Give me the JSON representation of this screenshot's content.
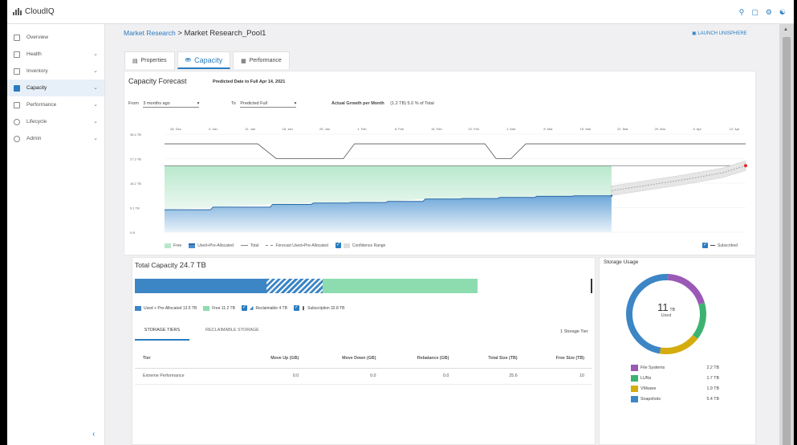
{
  "app": {
    "name": "CloudIQ"
  },
  "sidebar": {
    "items": [
      {
        "label": "Overview",
        "chevron": false,
        "active": false
      },
      {
        "label": "Health",
        "chevron": true,
        "active": false
      },
      {
        "label": "Inventory",
        "chevron": true,
        "active": false
      },
      {
        "label": "Capacity",
        "chevron": true,
        "active": true
      },
      {
        "label": "Performance",
        "chevron": true,
        "active": false
      },
      {
        "label": "Lifecycle",
        "chevron": true,
        "active": false
      },
      {
        "label": "Admin",
        "chevron": true,
        "active": false
      }
    ]
  },
  "header": {
    "breadcrumb_link": "Market Research",
    "breadcrumb_sep": " > ",
    "breadcrumb_current": "Market Research_Pool1",
    "launch": "LAUNCH UNISPHERE"
  },
  "tabs": [
    {
      "label": "Properties",
      "icon": "properties-icon"
    },
    {
      "label": "Capacity",
      "icon": "database-icon"
    },
    {
      "label": "Performance",
      "icon": "chart-icon"
    }
  ],
  "forecast": {
    "title": "Capacity Forecast",
    "subtitle": "Predicted Date to Full Apr 14, 2021",
    "from_label": "From",
    "from_value": "3 months ago",
    "to_label": "To",
    "to_value": "Predicted Full",
    "growth_label": "Actual Growth per Month",
    "growth_value": "(1.2 TB) 5.0 % of Total"
  },
  "chart_data": {
    "type": "area",
    "x_dates": [
      "28. Dec",
      "4. Jan",
      "11. Jan",
      "18. Jan",
      "25. Jan",
      "1. Feb",
      "8. Feb",
      "15. Feb",
      "22. Feb",
      "1. Mar",
      "8. Mar",
      "15. Mar",
      "22. Mar",
      "29. Mar",
      "5. Apr",
      "12. Apr"
    ],
    "y_ticks": [
      "36.4 TB",
      "27.3 TB",
      "18.2 TB",
      "9.1 TB",
      "0 B"
    ],
    "ylim": [
      0,
      36.4
    ],
    "series": [
      {
        "name": "Total",
        "values": [
          24.7,
          24.7,
          24.7,
          24.7,
          24.7,
          24.7,
          24.7,
          24.7,
          24.7,
          24.7,
          24.7,
          24.7
        ]
      },
      {
        "name": "Used+Pre-Allocated",
        "x": [
          0,
          1.3,
          2.9,
          4.0,
          5.0,
          6.0,
          7.0,
          8.0,
          9.0,
          10.0,
          11.0,
          12.0
        ],
        "values": [
          8.3,
          9.3,
          10.3,
          10.8,
          11.0,
          11.4,
          12.3,
          12.5,
          12.9,
          13.3,
          13.5,
          13.5
        ]
      },
      {
        "name": "Forecast Used+Pre-Allocated",
        "x": [
          12.0,
          13.0,
          14.0,
          15.0,
          15.6
        ],
        "values": [
          15.4,
          17.5,
          19.6,
          22.1,
          24.7
        ]
      },
      {
        "name": "Subscribed",
        "x": [
          0,
          2.5,
          3.0,
          4.8,
          5.1,
          8.6,
          8.9,
          9.3,
          9.7,
          15.6
        ],
        "values": [
          32.8,
          32.8,
          27.3,
          27.3,
          32.8,
          32.8,
          27.3,
          27.3,
          32.8,
          32.8
        ]
      }
    ],
    "legend": [
      "Free",
      "Used+Pre-Allocated",
      "Total",
      "Forecast Used+Pre-Allocated",
      "Confidence Range"
    ],
    "legend_right": "Subscribed",
    "colors": {
      "used": "#4d8ecb",
      "free": "#b8e8cc",
      "line": "#6d6d6d",
      "forecast": "#c8c8c8",
      "accent": "#2b7bc0",
      "point": "#e02b2b"
    }
  },
  "total_capacity": {
    "label": "Total Capacity",
    "value": "24.7 TB",
    "segments": [
      {
        "name": "used",
        "fraction": 0.288,
        "color": "#3d86c6"
      },
      {
        "name": "reclaimable",
        "fraction": 0.124,
        "color": "#7aa6d2"
      },
      {
        "name": "free",
        "fraction": 0.34,
        "color": "#8ddcb0"
      }
    ],
    "legend": [
      {
        "label": "Used + Pre-Allocated 13.5 TB",
        "color": "#3d86c6"
      },
      {
        "label": "Free 11.2 TB",
        "color": "#8ddcb0"
      },
      {
        "label": "Reclaimable 4 TB",
        "color": "#2b7bc0"
      },
      {
        "label": "Subscription 32.8 TB",
        "color": "#2b7bc0"
      }
    ]
  },
  "storage_tabs": {
    "tiers": "STORAGE TIERS",
    "reclaimable": "RECLAIMABLE STORAGE",
    "count": "1 Storage Tier"
  },
  "table": {
    "columns": [
      "Tier",
      "Move Up (GB)",
      "Move Down (GB)",
      "Rebalance (GB)",
      "Total Size (TB)",
      "Free Size (TB)"
    ],
    "rows": [
      [
        "Extreme Performance",
        "0.0",
        "0.0",
        "0.0",
        "25.6",
        "10"
      ]
    ]
  },
  "storage_usage": {
    "title": "Storage Usage",
    "center_value": "11",
    "center_unit": "TB",
    "center_label": "Used",
    "items": [
      {
        "label": "File Systems",
        "value": "2.2 TB",
        "color": "#9b59b6"
      },
      {
        "label": "LUNs",
        "value": "1.7 TB",
        "color": "#3cb371"
      },
      {
        "label": "VMware",
        "value": "1.9 TB",
        "color": "#d4ac0d"
      },
      {
        "label": "Snapshots",
        "value": "5.4 TB",
        "color": "#3d86c6"
      }
    ]
  }
}
